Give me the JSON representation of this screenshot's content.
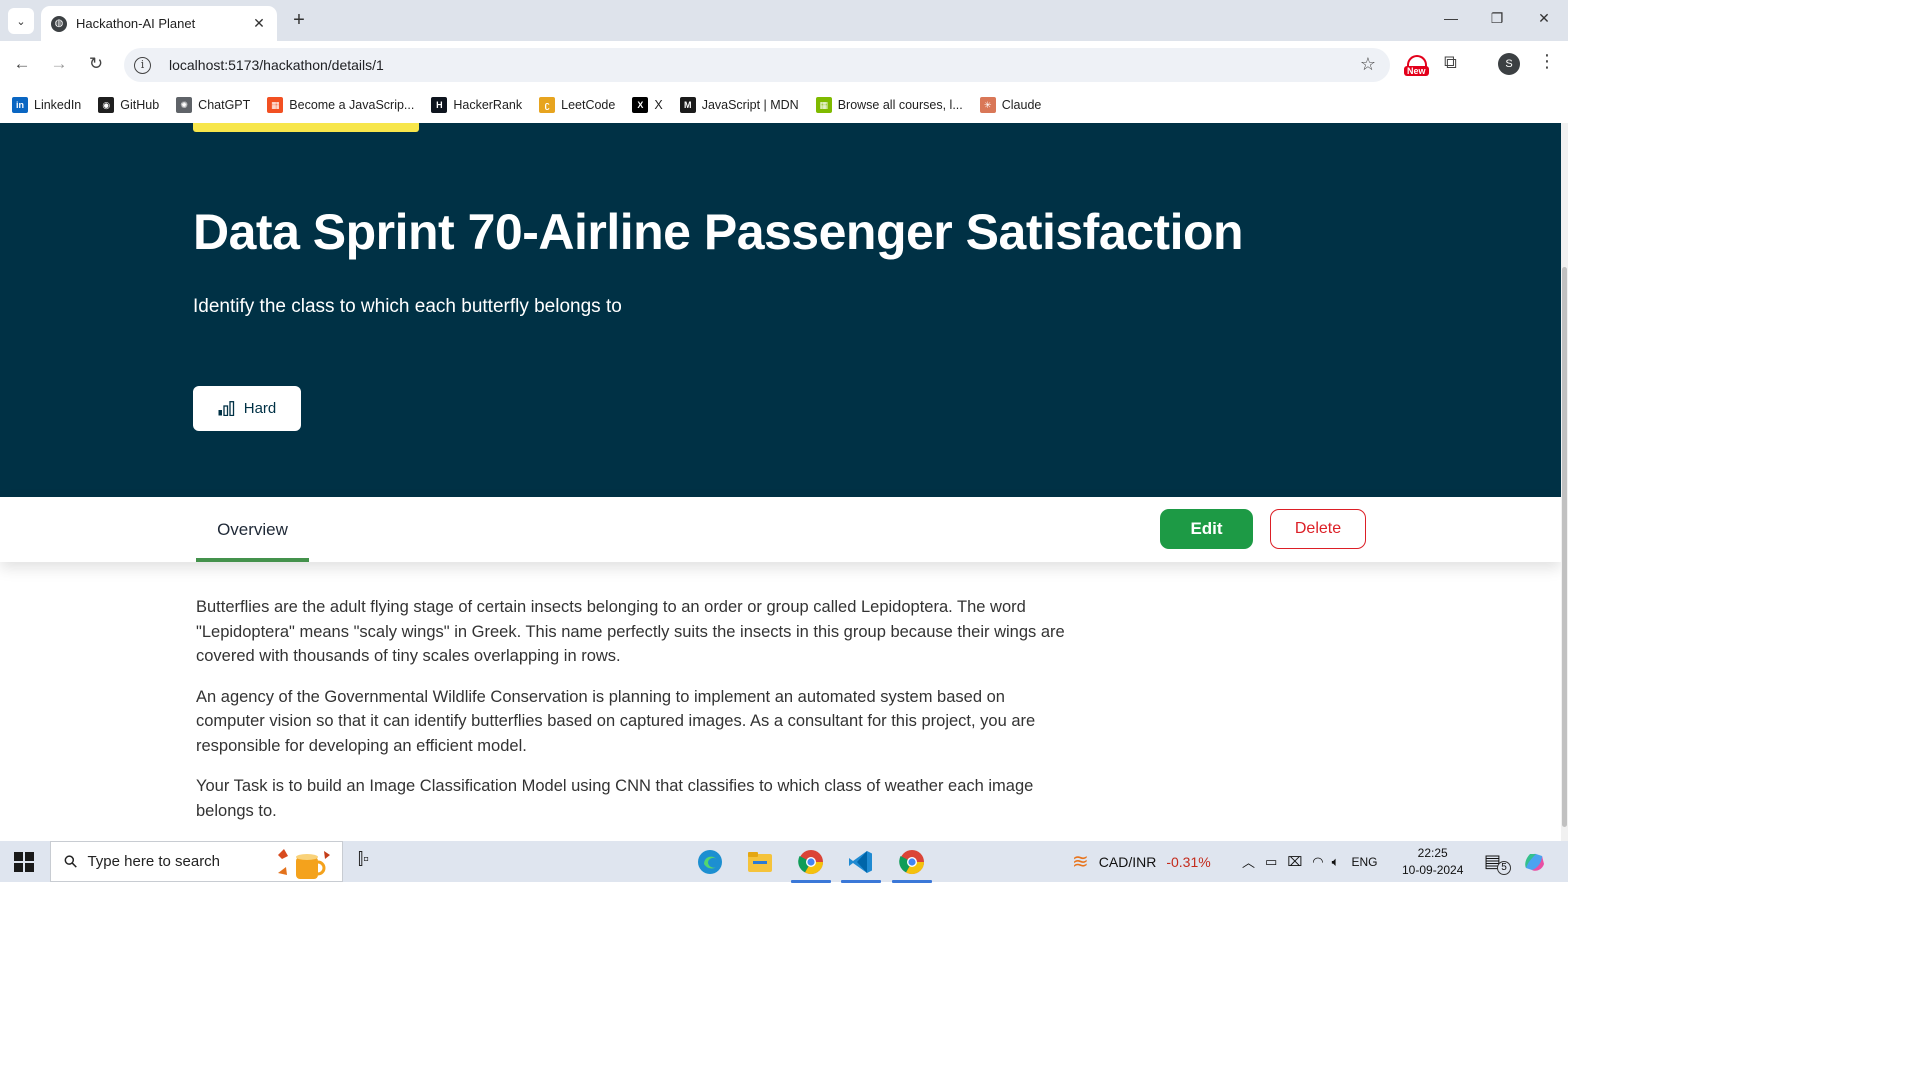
{
  "browser": {
    "tab_title": "Hackathon-AI Planet",
    "url": "localhost:5173/hackathon/details/1",
    "new_badge": "New",
    "profile_initial": "S",
    "bookmarks": [
      {
        "label": "LinkedIn",
        "icon": "linkedin-icon",
        "color": "#0a66c2",
        "glyph": "in"
      },
      {
        "label": "GitHub",
        "icon": "github-icon",
        "color": "#1f1f1f",
        "glyph": "◉"
      },
      {
        "label": "ChatGPT",
        "icon": "chatgpt-icon",
        "color": "#5f6368",
        "glyph": "✺"
      },
      {
        "label": "Become a JavaScrip...",
        "icon": "microsoft-icon",
        "color": "#f25022",
        "glyph": "▦"
      },
      {
        "label": "HackerRank",
        "icon": "hackerrank-icon",
        "color": "#0e141e",
        "glyph": "H"
      },
      {
        "label": "LeetCode",
        "icon": "leetcode-icon",
        "color": "#e7a41f",
        "glyph": "ʗ"
      },
      {
        "label": "X",
        "icon": "x-icon",
        "color": "#000000",
        "glyph": "X"
      },
      {
        "label": "JavaScript | MDN",
        "icon": "mdn-icon",
        "color": "#1b1b1b",
        "glyph": "M"
      },
      {
        "label": "Browse all courses, l...",
        "icon": "microsoft-icon",
        "color": "#7fba00",
        "glyph": "▦"
      },
      {
        "label": "Claude",
        "icon": "claude-icon",
        "color": "#d97757",
        "glyph": "✳"
      }
    ]
  },
  "hero": {
    "title": "Data Sprint 70-Airline Passenger Satisfaction",
    "subtitle": "Identify the class to which each butterfly belongs to",
    "level": "Hard",
    "bg_color": "#003145",
    "tag_color": "#f7e64b"
  },
  "tabs": {
    "overview": "Overview",
    "edit": "Edit",
    "delete": "Delete"
  },
  "description": {
    "paragraphs": [
      "Butterflies are the adult flying stage of certain insects belonging to an order or group called Lepidoptera. The word \"Lepidoptera\" means \"scaly wings\" in Greek. This name perfectly suits the insects in this group because their wings are covered with thousands of tiny scales overlapping in rows.",
      "An agency of the Governmental Wildlife Conservation is planning to implement an automated system based on computer vision so that it can identify butterflies based on captured images. As a consultant for this project, you are responsible for developing an efficient model.",
      "Your Task is to build an Image Classification Model using CNN that classifies to which class of weather each image belongs to."
    ]
  },
  "taskbar": {
    "search_placeholder": "Type here to search",
    "ticker": "CAD/INR",
    "ticker_change": "-0.31%",
    "language": "ENG",
    "time": "22:25",
    "date": "10-09-2024",
    "notifications": "5"
  }
}
